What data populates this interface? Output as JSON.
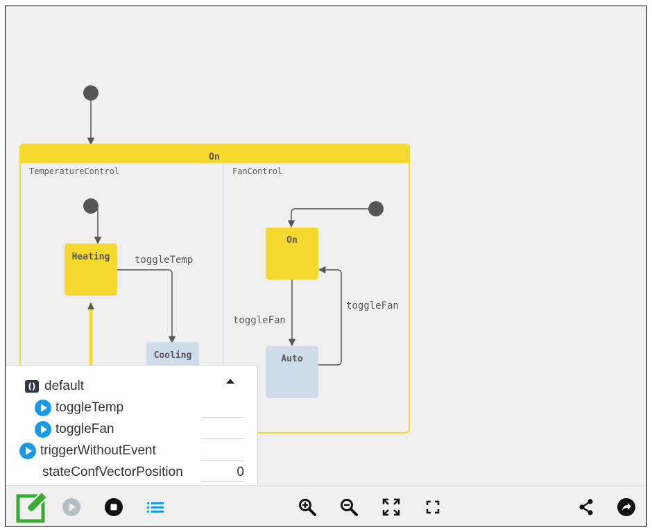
{
  "diagram": {
    "parent_state": "On",
    "regions": [
      {
        "name": "TemperatureControl",
        "states": [
          "Heating",
          "Cooling"
        ],
        "transition": "toggleTemp"
      },
      {
        "name": "FanControl",
        "states": [
          "On",
          "Auto"
        ],
        "transitions": [
          "toggleFan",
          "toggleFan"
        ]
      }
    ],
    "colors": {
      "active": "#f5d92e",
      "inactive": "#cfdce9",
      "initial": "#555555"
    }
  },
  "interface": {
    "name": "default",
    "events": [
      {
        "label": "toggleTemp",
        "value": ""
      },
      {
        "label": "toggleFan",
        "value": ""
      }
    ],
    "trigger": {
      "label": "triggerWithoutEvent",
      "value": ""
    },
    "variable": {
      "label": "stateConfVectorPosition",
      "value": "0"
    }
  },
  "toolbar": {
    "left": [
      "edit-icon",
      "play-icon",
      "stop-icon",
      "list-icon"
    ],
    "center": [
      "zoom-in-icon",
      "zoom-out-icon",
      "fit-icon",
      "fullscreen-icon"
    ],
    "right": [
      "share-icon",
      "forward-icon"
    ],
    "accent": "#3aaa35"
  }
}
